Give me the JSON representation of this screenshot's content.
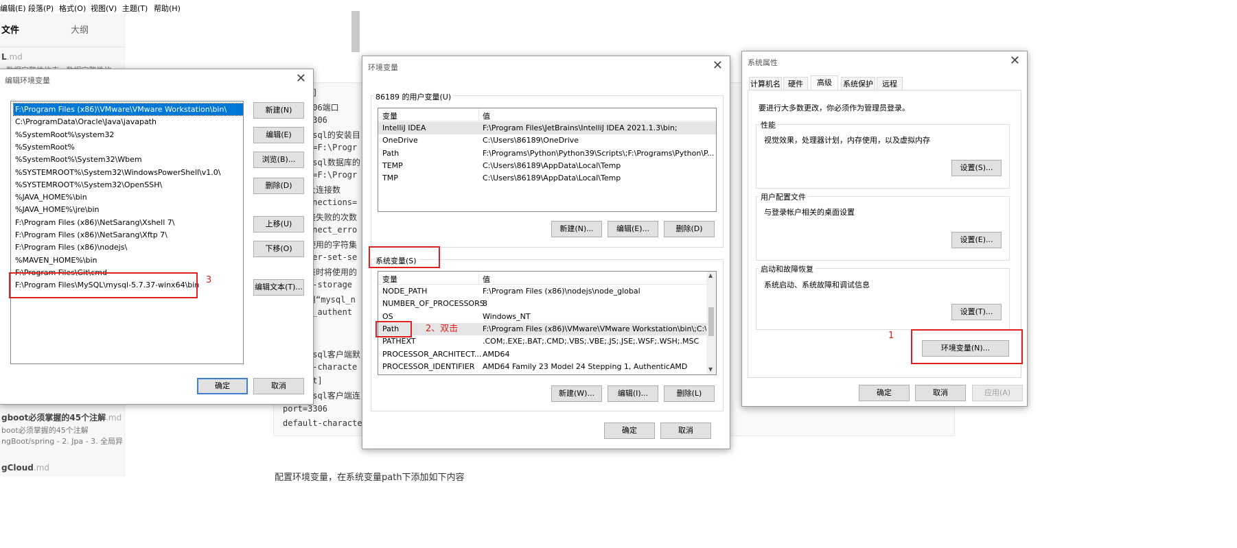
{
  "editor": {
    "menu": [
      "编辑(E)",
      "段落(P)",
      "格式(O)",
      "视图(V)",
      "主题(T)",
      "帮助(H)"
    ],
    "sidebar": {
      "tabs": [
        "文件",
        "大纲"
      ],
      "files": [
        {
          "title": "L",
          "ext": ".md",
          "desc": "· 数据完整性约束 · 数据完整性约"
        },
        {
          "title": "gboot必须掌握的45个注解",
          "ext": ".md",
          "desc1": "boot必须掌握的45个注解",
          "desc2": "ngBoot/spring - 2. Jpa - 3. 全局异"
        },
        {
          "title": "gCloud",
          "ext": ".md"
        }
      ]
    },
    "code_lines": [
      "d]",
      "306端口",
      "3306",
      "ysql的安装目",
      "r=F:\\Progr",
      "ysql数据库的",
      "r=F:\\Progr",
      "大连接数",
      "nnections=",
      "接失败的次数",
      "nnect_erro",
      "使用的字符集",
      "ter-set-se",
      "表时将使用的",
      "t-storage",
      "用“mysql_n",
      "t_authent",
      "]",
      "ysql客户端默",
      "t-characte",
      "nt]",
      "ysql客户端连",
      "port=3306",
      "default-characte"
    ],
    "bottom_text": "配置环境变量，在系统变量path下添加如下内容"
  },
  "edit_env_dialog": {
    "title": "编辑环境变量",
    "close": "✕",
    "paths": [
      "F:\\Program Files (x86)\\VMware\\VMware Workstation\\bin\\",
      "C:\\ProgramData\\Oracle\\Java\\javapath",
      "%SystemRoot%\\system32",
      "%SystemRoot%",
      "%SystemRoot%\\System32\\Wbem",
      "%SYSTEMROOT%\\System32\\WindowsPowerShell\\v1.0\\",
      "%SYSTEMROOT%\\System32\\OpenSSH\\",
      "%JAVA_HOME%\\bin",
      "%JAVA_HOME%\\jre\\bin",
      "F:\\Program Files (x86)\\NetSarang\\Xshell 7\\",
      "F:\\Program Files (x86)\\NetSarang\\Xftp 7\\",
      "F:\\Program Files (x86)\\nodejs\\",
      "%MAVEN_HOME%\\bin",
      "F:\\Program Files\\Git\\cmd",
      "F:\\Program Files\\MySQL\\mysql-5.7.37-winx64\\bin"
    ],
    "buttons": {
      "new": "新建(N)",
      "edit": "编辑(E)",
      "browse": "浏览(B)...",
      "delete": "删除(D)",
      "up": "上移(U)",
      "down": "下移(O)",
      "edit_text": "编辑文本(T)...",
      "ok": "确定",
      "cancel": "取消"
    },
    "annotation": "3"
  },
  "env_vars_dialog": {
    "title": "环境变量",
    "close": "✕",
    "user_group": "86189 的用户变量(U)",
    "columns": [
      "变量",
      "值"
    ],
    "user_vars": [
      {
        "name": "IntelliJ IDEA",
        "value": "F:\\Program Files\\JetBrains\\IntelliJ IDEA 2021.1.3\\bin;"
      },
      {
        "name": "OneDrive",
        "value": "C:\\Users\\86189\\OneDrive"
      },
      {
        "name": "Path",
        "value": "F:\\Programs\\Python\\Python39\\Scripts\\;F:\\Programs\\Python\\P..."
      },
      {
        "name": "TEMP",
        "value": "C:\\Users\\86189\\AppData\\Local\\Temp"
      },
      {
        "name": "TMP",
        "value": "C:\\Users\\86189\\AppData\\Local\\Temp"
      }
    ],
    "user_buttons": {
      "new": "新建(N)...",
      "edit": "编辑(E)...",
      "delete": "删除(D)"
    },
    "system_group": "系统变量(S)",
    "system_vars": [
      {
        "name": "NODE_PATH",
        "value": "F:\\Program Files (x86)\\nodejs\\node_global"
      },
      {
        "name": "NUMBER_OF_PROCESSORS",
        "value": "8"
      },
      {
        "name": "OS",
        "value": "Windows_NT"
      },
      {
        "name": "Path",
        "value": "F:\\Program Files (x86)\\VMware\\VMware Workstation\\bin\\;C:\\..."
      },
      {
        "name": "PATHEXT",
        "value": ".COM;.EXE;.BAT;.CMD;.VBS;.VBE;.JS;.JSE;.WSF;.WSH;.MSC"
      },
      {
        "name": "PROCESSOR_ARCHITECT...",
        "value": "AMD64"
      },
      {
        "name": "PROCESSOR_IDENTIFIER",
        "value": "AMD64 Family 23 Model 24 Stepping 1, AuthenticAMD"
      }
    ],
    "system_buttons": {
      "new": "新建(W)...",
      "edit": "编辑(I)...",
      "delete": "删除(L)"
    },
    "ok": "确定",
    "cancel": "取消",
    "annotation": "2、双击"
  },
  "sys_props_dialog": {
    "title": "系统属性",
    "close": "✕",
    "tabs": [
      "计算机名",
      "硬件",
      "高级",
      "系统保护",
      "远程"
    ],
    "admin_note": "要进行大多数更改，你必须作为管理员登录。",
    "perf": {
      "label": "性能",
      "desc": "视觉效果，处理器计划，内存使用，以及虚拟内存",
      "button": "设置(S)..."
    },
    "profile": {
      "label": "用户配置文件",
      "desc": "与登录帐户相关的桌面设置",
      "button": "设置(E)..."
    },
    "startup": {
      "label": "启动和故障恢复",
      "desc": "系统启动、系统故障和调试信息",
      "button": "设置(T)..."
    },
    "env_button": "环境变量(N)...",
    "ok": "确定",
    "cancel": "取消",
    "apply": "应用(A)",
    "annotation": "1"
  }
}
